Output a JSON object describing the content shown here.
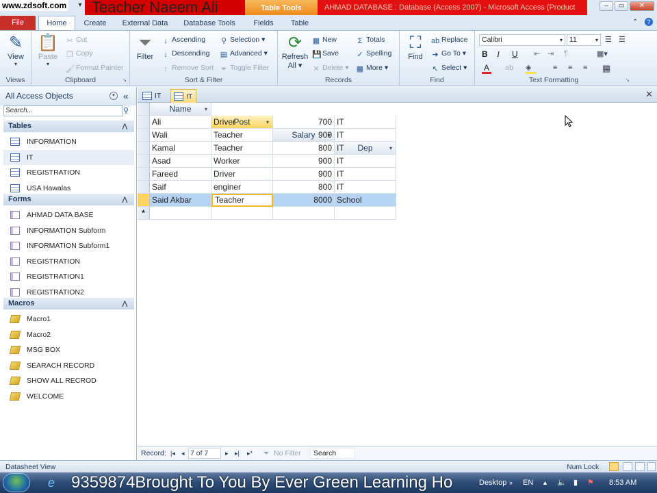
{
  "titlebar": {
    "watermark": "www.zdsoft.com",
    "banner": "Teacher Naeem Ali",
    "context_tab": "Table Tools",
    "window_title": "AHMAD DATABASE : Database (Access 2007) - Microsoft Access (Product",
    "controls": [
      "–",
      "▭",
      "✕"
    ]
  },
  "tabs": [
    "File",
    "Home",
    "Create",
    "External Data",
    "Database Tools",
    "Fields",
    "Table"
  ],
  "ribbon": {
    "views": {
      "view": "View",
      "label": "Views"
    },
    "clipboard": {
      "paste": "Paste",
      "cut": "Cut",
      "copy": "Copy",
      "format_painter": "Format Painter",
      "label": "Clipboard"
    },
    "sort_filter": {
      "filter": "Filter",
      "ascending": "Ascending",
      "descending": "Descending",
      "remove_sort": "Remove Sort",
      "selection": "Selection",
      "advanced": "Advanced",
      "toggle_filter": "Toggle Filter",
      "label": "Sort & Filter"
    },
    "records": {
      "refresh": "Refresh",
      "refresh_sub": "All",
      "new": "New",
      "save": "Save",
      "delete": "Delete",
      "totals": "Totals",
      "spelling": "Spelling",
      "more": "More",
      "label": "Records"
    },
    "find": {
      "find": "Find",
      "replace": "Replace",
      "goto": "Go To",
      "select": "Select",
      "label": "Find"
    },
    "text_formatting": {
      "font": "Calibri",
      "size": "11",
      "bold": "B",
      "italic": "I",
      "underline": "U",
      "label": "Text Formatting"
    }
  },
  "nav": {
    "title": "All Access Objects",
    "search_placeholder": "Search...",
    "sections": [
      {
        "name": "Tables",
        "items": [
          "INFORMATION",
          "IT",
          "REGISTRATION",
          "USA Hawalas"
        ]
      },
      {
        "name": "Forms",
        "items": [
          "AHMAD DATA BASE",
          "INFORMATION Subform",
          "INFORMATION Subform1",
          "REGISTRATION",
          "REGISTRATION1",
          "REGISTRATION2"
        ]
      },
      {
        "name": "Macros",
        "items": [
          "Macro1",
          "Macro2",
          "MSG BOX",
          "SEARACH RECORD",
          "SHOW ALL RECROD",
          "WELCOME"
        ]
      }
    ]
  },
  "doc_tabs": [
    "IT",
    "IT"
  ],
  "table": {
    "columns": [
      "Name",
      "Post",
      "Salary",
      "Dep"
    ],
    "rows": [
      [
        "Ali",
        "Driver",
        "700",
        "IT"
      ],
      [
        "Wali",
        "Teacher",
        "900",
        "IT"
      ],
      [
        "Kamal",
        "Teacher",
        "800",
        "IT"
      ],
      [
        "Asad",
        "Worker",
        "900",
        "IT"
      ],
      [
        "Fareed",
        "Driver",
        "900",
        "IT"
      ],
      [
        "Saif",
        "enginer",
        "800",
        "IT"
      ],
      [
        "Said Akbar",
        "Teacher",
        "8000",
        "School"
      ]
    ],
    "new_row_marker": "*"
  },
  "record_nav": {
    "label": "Record:",
    "position": "7 of 7",
    "filter": "No Filter",
    "search": "Search"
  },
  "status": {
    "left": "Datasheet View",
    "numlock": "Num Lock"
  },
  "taskbar": {
    "ticker": "9359874Brought To You By Ever Green Learning Ho",
    "desktop": "Desktop",
    "lang": "EN",
    "time": "8:53 AM"
  },
  "colors": {
    "file_tab": "#c8302a",
    "banner": "#d40000",
    "selection": "#b7d3f2",
    "active": "#ffd45f"
  }
}
